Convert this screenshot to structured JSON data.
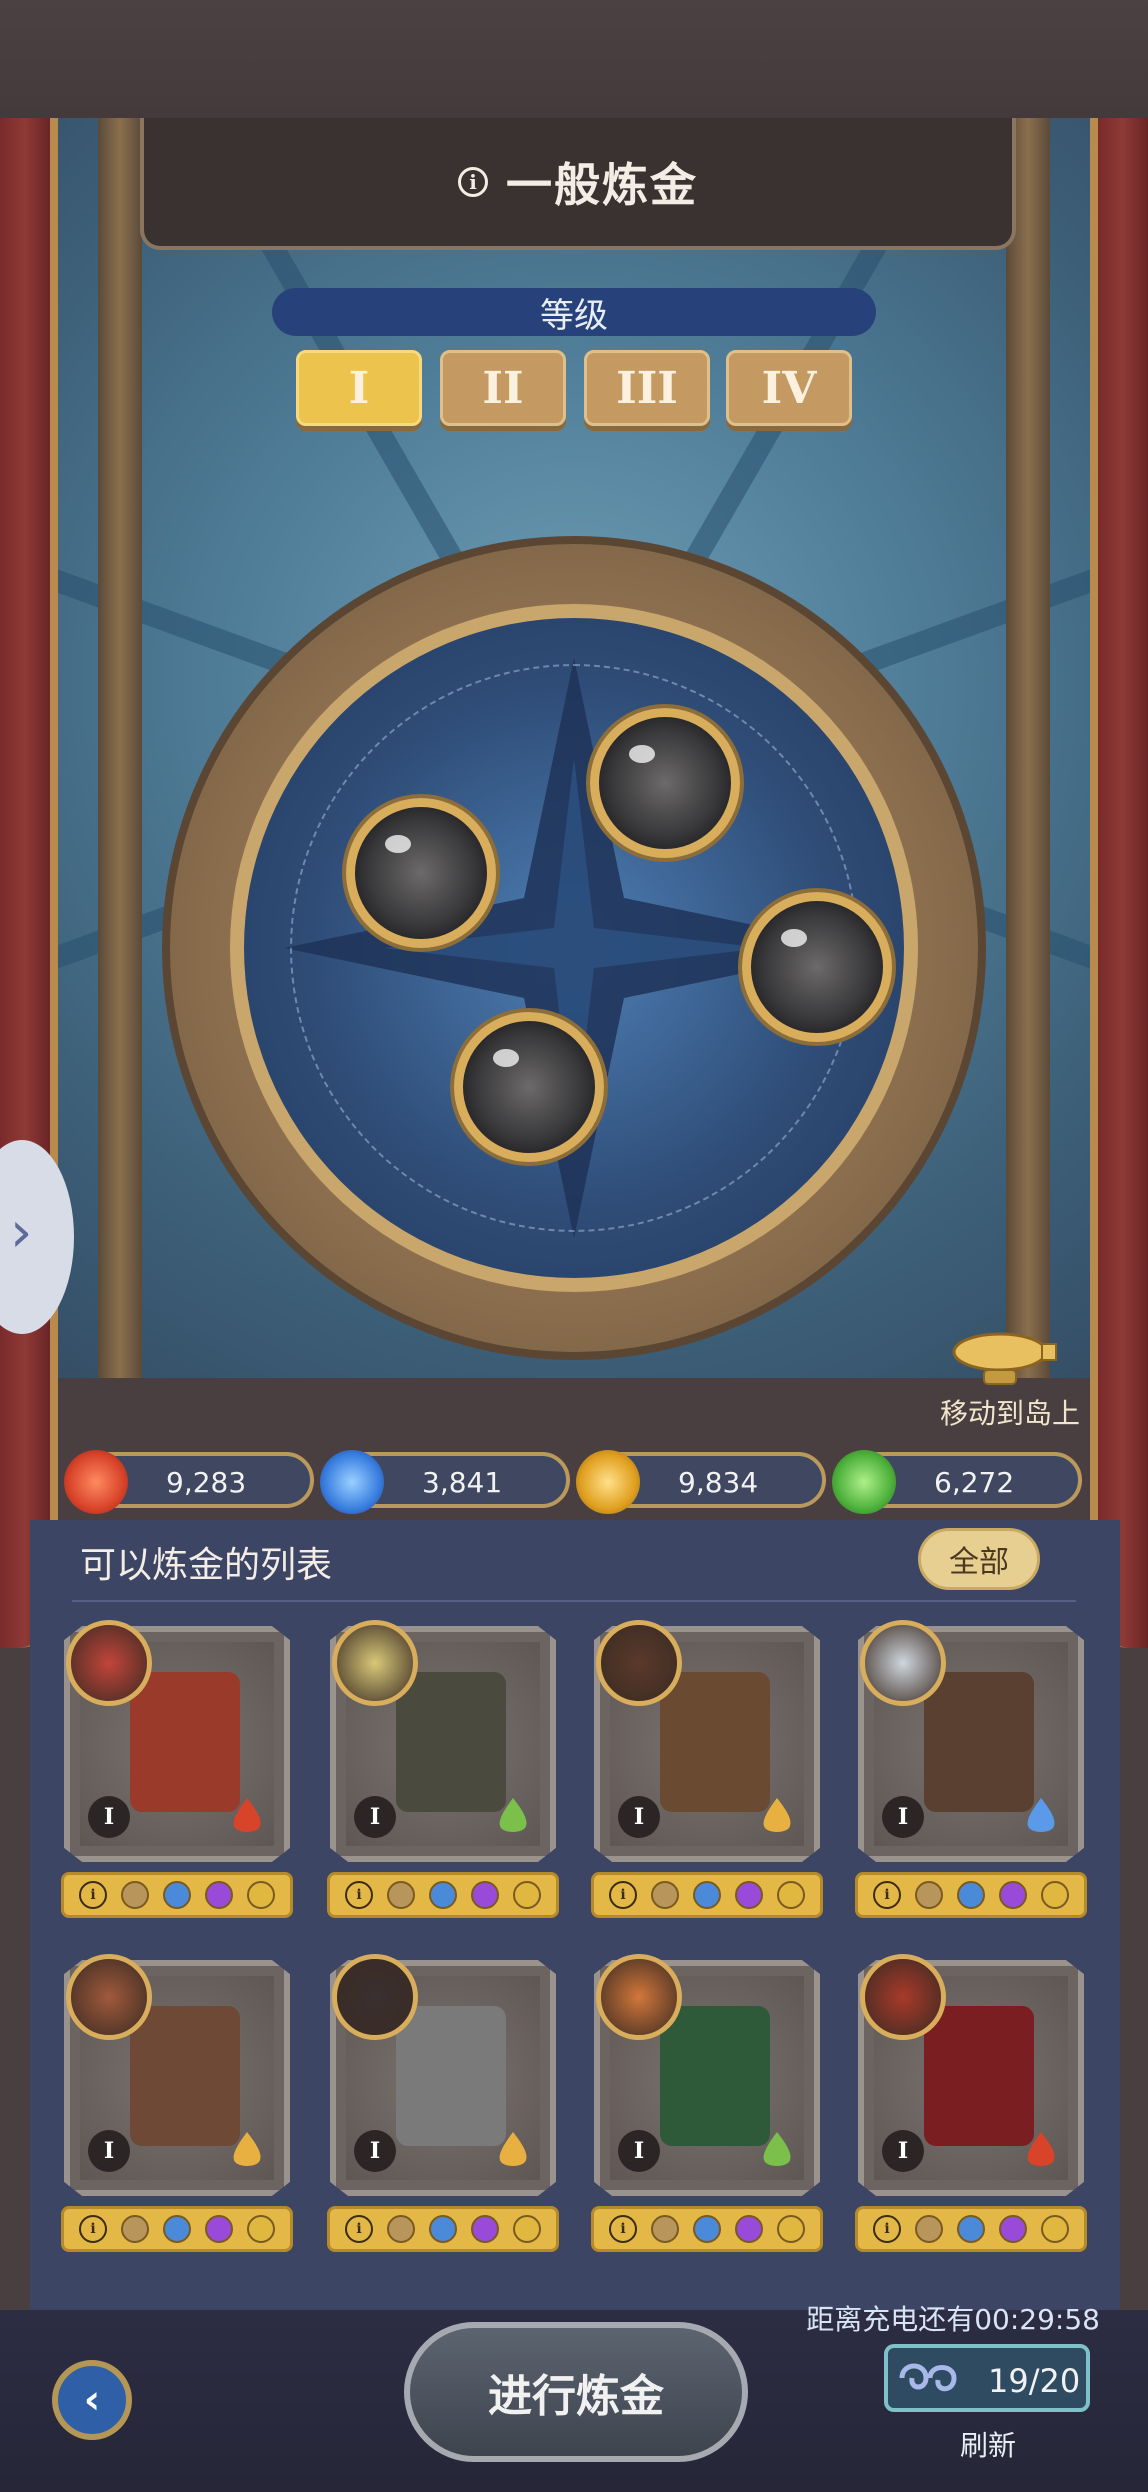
{
  "header": {
    "title": "一般炼金",
    "info_icon": "info-icon"
  },
  "grade": {
    "label": "等级",
    "tabs": [
      {
        "label": "I",
        "active": true
      },
      {
        "label": "II",
        "active": false
      },
      {
        "label": "III",
        "active": false
      },
      {
        "label": "IV",
        "active": false
      }
    ]
  },
  "wheel": {
    "materials": [
      "dark-material-icon",
      "dark-material-icon",
      "dark-material-icon",
      "dark-material-icon"
    ]
  },
  "move": {
    "label": "移动到岛上",
    "icon": "airship-icon"
  },
  "resources": [
    {
      "icon": "red-gem-icon",
      "color": "#d8442a",
      "value": "9,283"
    },
    {
      "icon": "blue-gem-icon",
      "color": "#3a7fe0",
      "value": "3,841"
    },
    {
      "icon": "gold-gem-icon",
      "color": "#e0a020",
      "value": "9,834"
    },
    {
      "icon": "green-gem-icon",
      "color": "#4fb23c",
      "value": "6,272"
    }
  ],
  "list": {
    "title": "可以炼金的列表",
    "filter_label": "全部",
    "items": [
      {
        "grade": "I",
        "element": "fire",
        "art_color": "#9a3a2a",
        "portrait_color": "#c2453a"
      },
      {
        "grade": "I",
        "element": "wind",
        "art_color": "#4a4a3e",
        "portrait_color": "#d8c878"
      },
      {
        "grade": "I",
        "element": "earth",
        "art_color": "#6b4a32",
        "portrait_color": "#5a3a2a"
      },
      {
        "grade": "I",
        "element": "water",
        "art_color": "#5a4030",
        "portrait_color": "#cfd6dc"
      },
      {
        "grade": "I",
        "element": "earth",
        "art_color": "#6e4a36",
        "portrait_color": "#a05a3c"
      },
      {
        "grade": "I",
        "element": "earth",
        "art_color": "#7a7a7a",
        "portrait_color": "#3a3030"
      },
      {
        "grade": "I",
        "element": "wind",
        "art_color": "#2f5a3a",
        "portrait_color": "#d2773a"
      },
      {
        "grade": "I",
        "element": "fire",
        "art_color": "#7a1e22",
        "portrait_color": "#a83a2a"
      }
    ],
    "req_colors": [
      "#b8955a",
      "#4a8ad8",
      "#9a4ad8",
      "#e0b840"
    ]
  },
  "footer": {
    "recharge_text": "距离充电还有00:29:58",
    "main_button": "进行炼金",
    "counter": "19/20",
    "refresh_label": "刷新"
  }
}
